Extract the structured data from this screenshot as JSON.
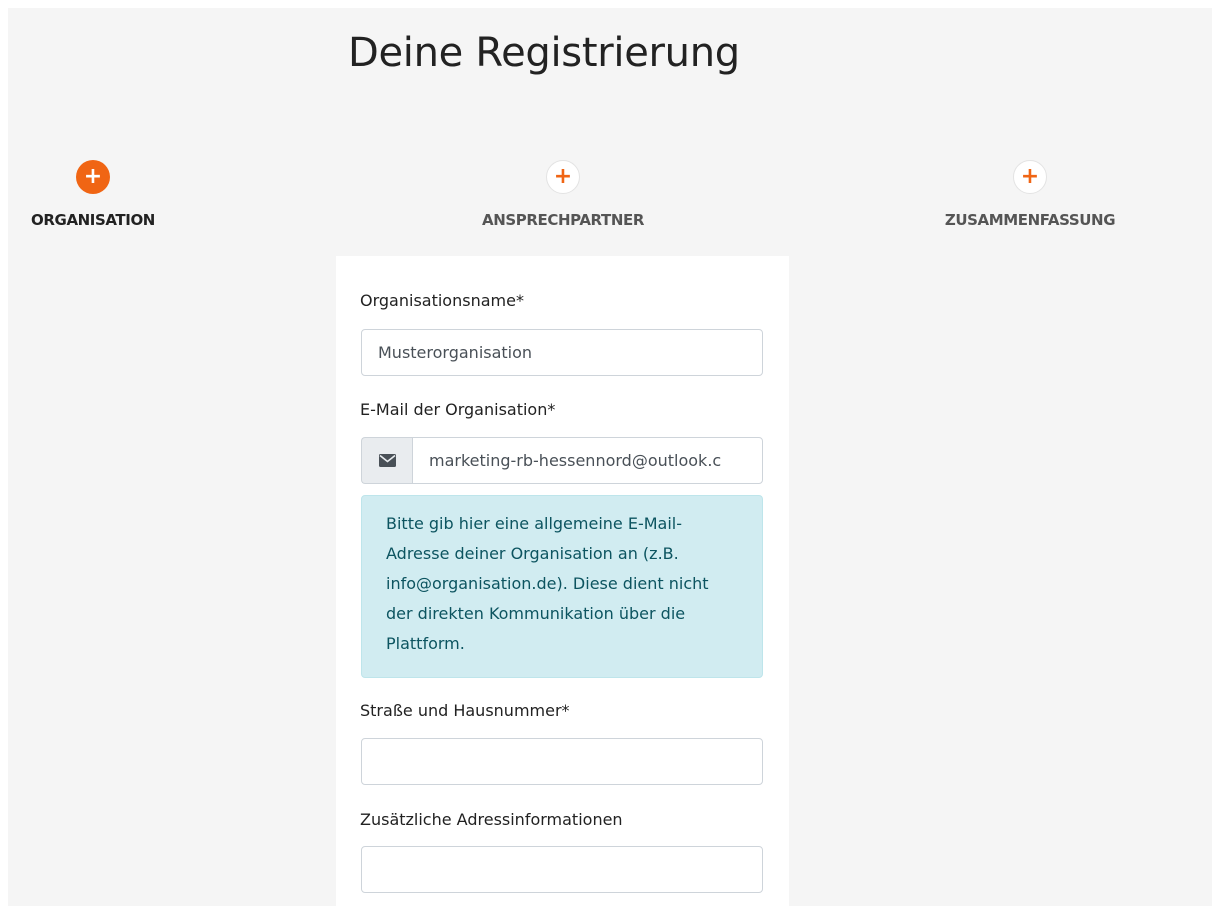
{
  "page": {
    "title": "Deine Registrierung"
  },
  "steps": [
    {
      "label": "ORGANISATION",
      "icon": "plus-icon",
      "active": true
    },
    {
      "label": "ANSPRECHPARTNER",
      "icon": "plus-icon",
      "active": false
    },
    {
      "label": "ZUSAMMENFASSUNG",
      "icon": "plus-icon",
      "active": false
    }
  ],
  "form": {
    "org_name": {
      "label": "Organisationsname*",
      "value": "Musterorganisation"
    },
    "email": {
      "label": "E-Mail der Organisation*",
      "icon": "envelope-icon",
      "value": "marketing-rb-hessennord@outlook.c"
    },
    "email_info": "Bitte gib hier eine allgemeine E-Mail-Adresse deiner Organisation an (z.B. info@organisation.de). Diese dient nicht der direkten Kommunikation über die Plattform.",
    "street": {
      "label": "Straße und Hausnummer*",
      "value": ""
    },
    "address_extra": {
      "label": "Zusätzliche Adressinformationen",
      "value": ""
    }
  },
  "colors": {
    "accent": "#f06514",
    "info_background": "#d1ecf1",
    "info_text": "#0c5460",
    "page_background": "#f5f5f5"
  }
}
